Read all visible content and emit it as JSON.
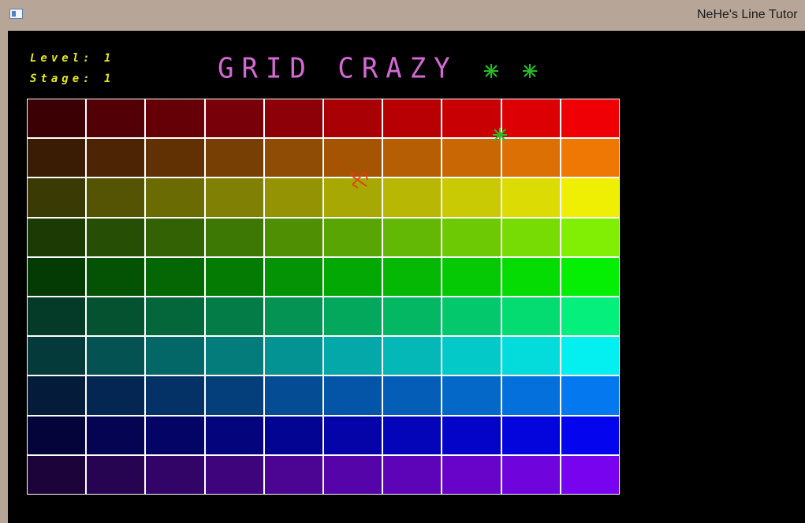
{
  "window": {
    "title": "NeHe's Line Tutor"
  },
  "hud": {
    "level_label": "Level:",
    "level_value": "1",
    "stage_label": "Stage:",
    "stage_value": "1"
  },
  "game_title": "GRID CRAZY",
  "lives": {
    "count": 2,
    "icon": "green-asterisk",
    "color": "#22c022"
  },
  "enemy": {
    "icon": "green-asterisk",
    "color": "#22c022"
  },
  "player": {
    "icon": "red-hourglass",
    "color": "#e03c14"
  },
  "grid": {
    "line_color": "#ffffff",
    "rows": [
      [
        "#3a0004",
        "#520006",
        "#650007",
        "#780008",
        "#8e0008",
        "#a80004",
        "#b80004",
        "#c80004",
        "#dc0004",
        "#ef0004"
      ],
      [
        "#3a1c04",
        "#4e2504",
        "#613104",
        "#773f04",
        "#8f4c04",
        "#a55404",
        "#b55e04",
        "#c86704",
        "#dc7004",
        "#ef7804"
      ],
      [
        "#3a3a04",
        "#545404",
        "#6b6b04",
        "#808004",
        "#939304",
        "#a8a804",
        "#b8b804",
        "#c9c904",
        "#dcdc04",
        "#efef04"
      ],
      [
        "#1c3a04",
        "#264e04",
        "#336204",
        "#3e7804",
        "#4e8f04",
        "#58a504",
        "#62b804",
        "#6cc904",
        "#76dc04",
        "#80ef04"
      ],
      [
        "#043a04",
        "#045204",
        "#046704",
        "#047c04",
        "#049304",
        "#04a804",
        "#04b804",
        "#04c904",
        "#04dc04",
        "#04ef04"
      ],
      [
        "#043a28",
        "#04522f",
        "#04673c",
        "#047c48",
        "#049352",
        "#04a85c",
        "#04b863",
        "#04c96c",
        "#04dc72",
        "#04ef7c"
      ],
      [
        "#043a3a",
        "#045252",
        "#046767",
        "#047c7c",
        "#049393",
        "#04a8a8",
        "#04b8b8",
        "#04c9c9",
        "#04dcdc",
        "#04efef"
      ],
      [
        "#041c3a",
        "#042652",
        "#043267",
        "#043f7c",
        "#044c93",
        "#0454a8",
        "#045eb8",
        "#0468c9",
        "#0470dc",
        "#0478ef"
      ],
      [
        "#04043a",
        "#040452",
        "#040467",
        "#04047c",
        "#040493",
        "#0404a8",
        "#0404b8",
        "#0404c9",
        "#0404dc",
        "#0404ef"
      ],
      [
        "#1c043a",
        "#260452",
        "#320467",
        "#3e047c",
        "#4c0493",
        "#5404a8",
        "#5e04b8",
        "#6804c9",
        "#7004dc",
        "#7804ef"
      ]
    ]
  }
}
